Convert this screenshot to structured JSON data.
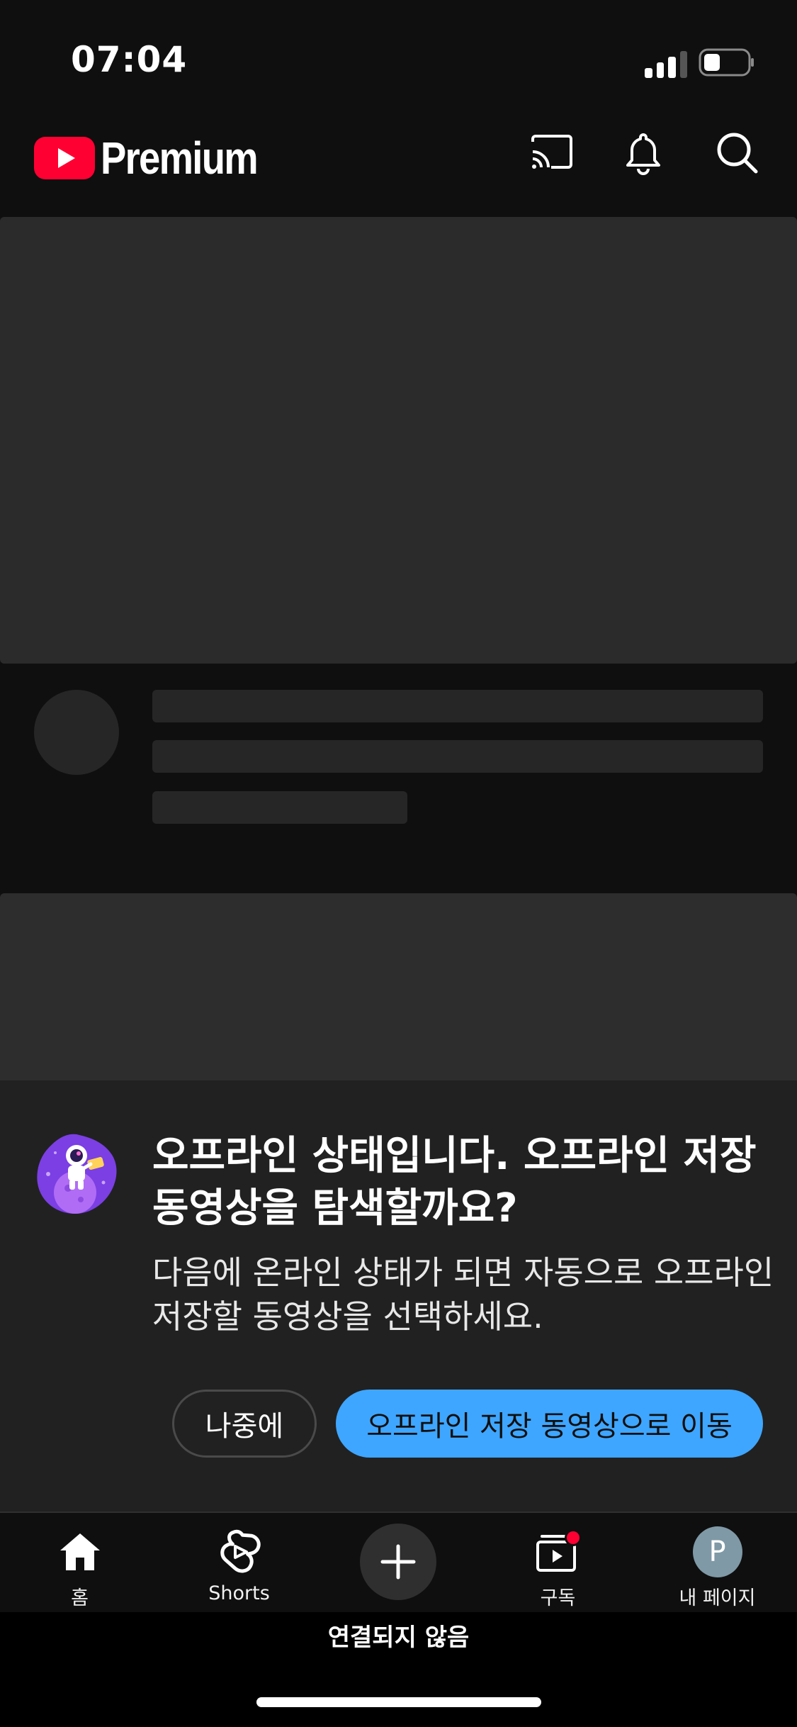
{
  "status_bar": {
    "time": "07:04"
  },
  "header": {
    "brand": "Premium"
  },
  "offline_prompt": {
    "title": "오프라인 상태입니다. 오프라인 저장 동영상을 탐색할까요?",
    "message": "다음에 온라인 상태가 되면 자동으로 오프라인 저장할 동영상을 선택하세요.",
    "later_label": "나중에",
    "go_label": "오프라인 저장 동영상으로 이동"
  },
  "nav": {
    "home_label": "홈",
    "shorts_label": "Shorts",
    "subscriptions_label": "구독",
    "profile_label": "내 페이지",
    "profile_initial": "P"
  },
  "connection_status": "연결되지 않음",
  "colors": {
    "brand_red": "#ff0033",
    "accent_blue": "#3ea6ff",
    "badge_red": "#ff0033"
  }
}
